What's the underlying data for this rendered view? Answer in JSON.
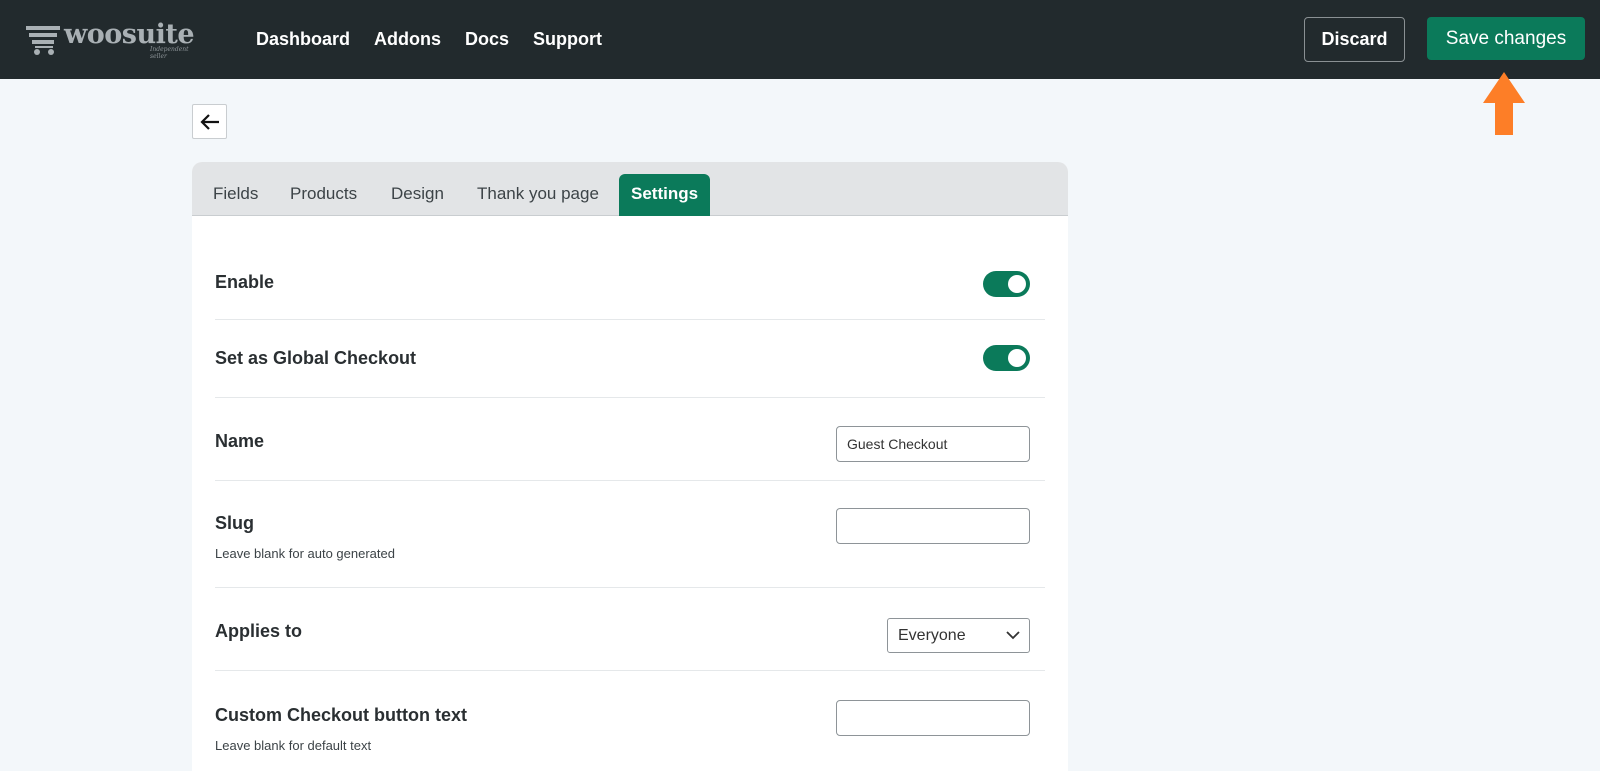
{
  "header": {
    "logo_text": "woosuite",
    "logo_tagline": "Independent seller",
    "nav": [
      "Dashboard",
      "Addons",
      "Docs",
      "Support"
    ],
    "discard_label": "Discard",
    "save_label": "Save changes"
  },
  "tabs": [
    "Fields",
    "Products",
    "Design",
    "Thank you page",
    "Settings"
  ],
  "active_tab": "Settings",
  "settings": {
    "enable": {
      "label": "Enable",
      "value": true
    },
    "global_checkout": {
      "label": "Set as Global Checkout",
      "value": true
    },
    "name": {
      "label": "Name",
      "value": "Guest Checkout"
    },
    "slug": {
      "label": "Slug",
      "hint": "Leave blank for auto generated",
      "value": ""
    },
    "applies_to": {
      "label": "Applies to",
      "value": "Everyone"
    },
    "custom_button_text": {
      "label": "Custom Checkout button text",
      "hint": "Leave blank for default text",
      "value": ""
    }
  },
  "colors": {
    "topbar": "#222a2d",
    "accent": "#0b7a5a",
    "arrow": "#fd7e27",
    "page_bg": "#f3f7fa"
  },
  "icons": {
    "logo": "cart-icon",
    "back": "arrow-left-icon",
    "annotation": "arrow-up-icon",
    "select": "chevron-down-icon"
  }
}
